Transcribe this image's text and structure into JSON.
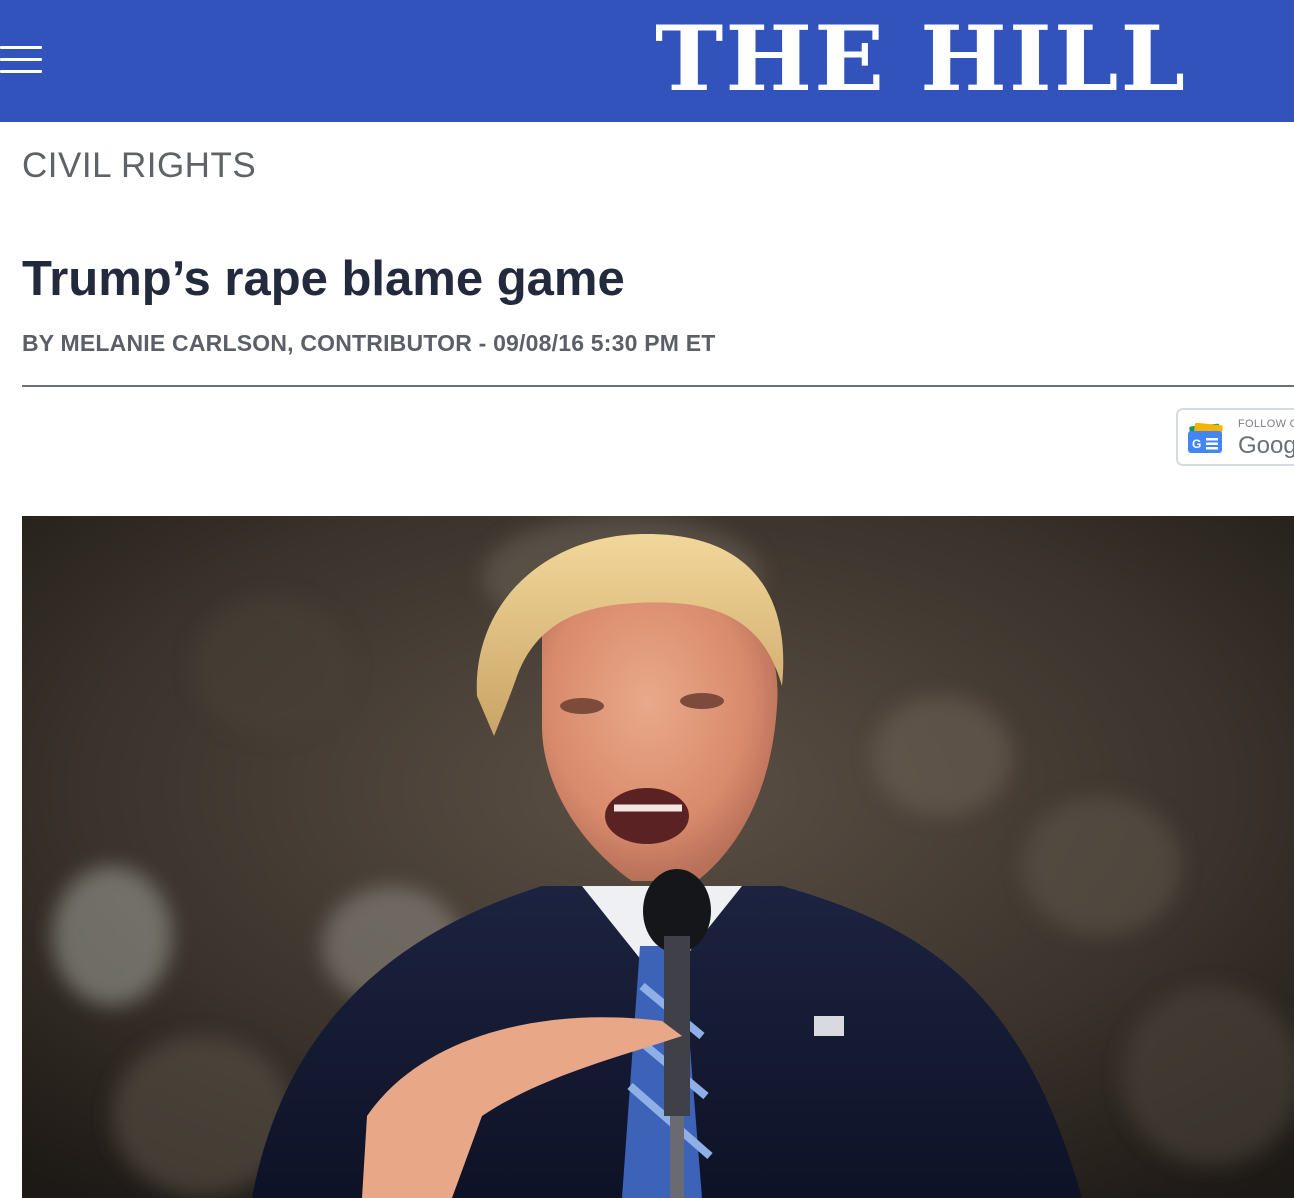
{
  "header": {
    "menu_icon": "hamburger-menu-icon",
    "logo_text": "THE HILL",
    "background_color": "#3153bb"
  },
  "article": {
    "section": "CIVIL RIGHTS",
    "headline": "Trump’s rape blame game",
    "byline": "BY MELANIE CARLSON, CONTRIBUTOR - 09/08/16 5:30 PM ET"
  },
  "follow_button": {
    "icon": "google-news-icon",
    "top_label": "FOLLOW O",
    "bottom_label": "Goog"
  },
  "hero_image": {
    "subject": "photo"
  }
}
